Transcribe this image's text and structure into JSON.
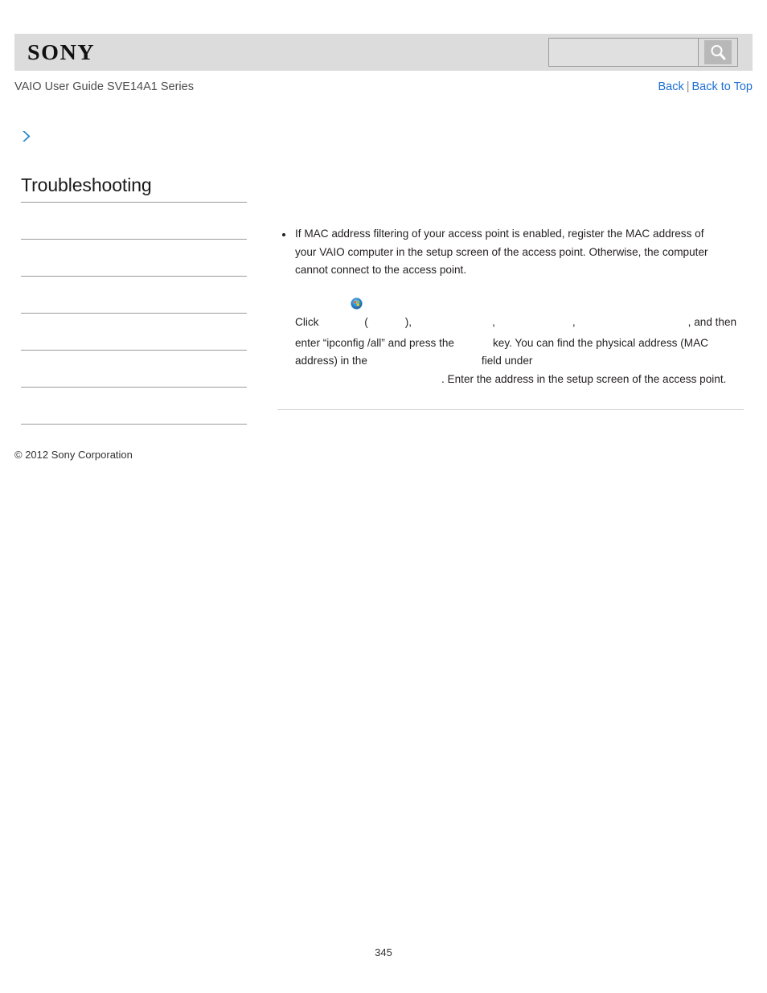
{
  "header": {
    "logo_text": "SONY",
    "search": {
      "value": "",
      "placeholder": "",
      "icon": "search-icon",
      "button_label": ""
    }
  },
  "title_row": {
    "guide_title": "VAIO User Guide SVE14A1 Series",
    "links": {
      "back": "Back",
      "separator": "|",
      "back_to_top": "Back to Top"
    }
  },
  "breadcrumb": {
    "icon": "chevron-right-icon",
    "text": ""
  },
  "sidebar": {
    "heading": "Troubleshooting",
    "items": [
      {
        "label": ""
      },
      {
        "label": ""
      },
      {
        "label": ""
      },
      {
        "label": ""
      },
      {
        "label": ""
      },
      {
        "label": ""
      }
    ]
  },
  "content": {
    "bullets": [
      {
        "lines": [
          "If MAC address filtering of your access point is enabled, register the MAC address of",
          "your VAIO computer in the setup screen of the access point. Otherwise, the computer",
          "cannot connect to the access point."
        ],
        "instruction": {
          "click_label": "Click",
          "orb_icon": "windows-start-orb-icon",
          "paren_open": "(",
          "start_menu_name": "",
          "paren_close": "),",
          "step_2": "",
          "comma_1": ",",
          "step_3": "",
          "comma_2": ",",
          "step_4": "",
          "and_then": ", and then",
          "enter_command": "enter “ipconfig /all” and press the",
          "enter_key_name": "",
          "key_suffix": "key. You can find the physical address (MAC",
          "address_prefix": "address) in the",
          "field_name": "",
          "field_suffix": "field under",
          "adapter_name": "",
          "final_sentence": ". Enter the address in the setup screen of the access point."
        }
      }
    ]
  },
  "footer": {
    "copyright": "© 2012 Sony Corporation",
    "page_number": "345"
  },
  "colors": {
    "link": "#1a6fd4",
    "header_bg": "#dcdcdc",
    "rule": "#9b9b9b",
    "content_rule": "#d2d2d2",
    "chevron": "#2e86c8"
  }
}
